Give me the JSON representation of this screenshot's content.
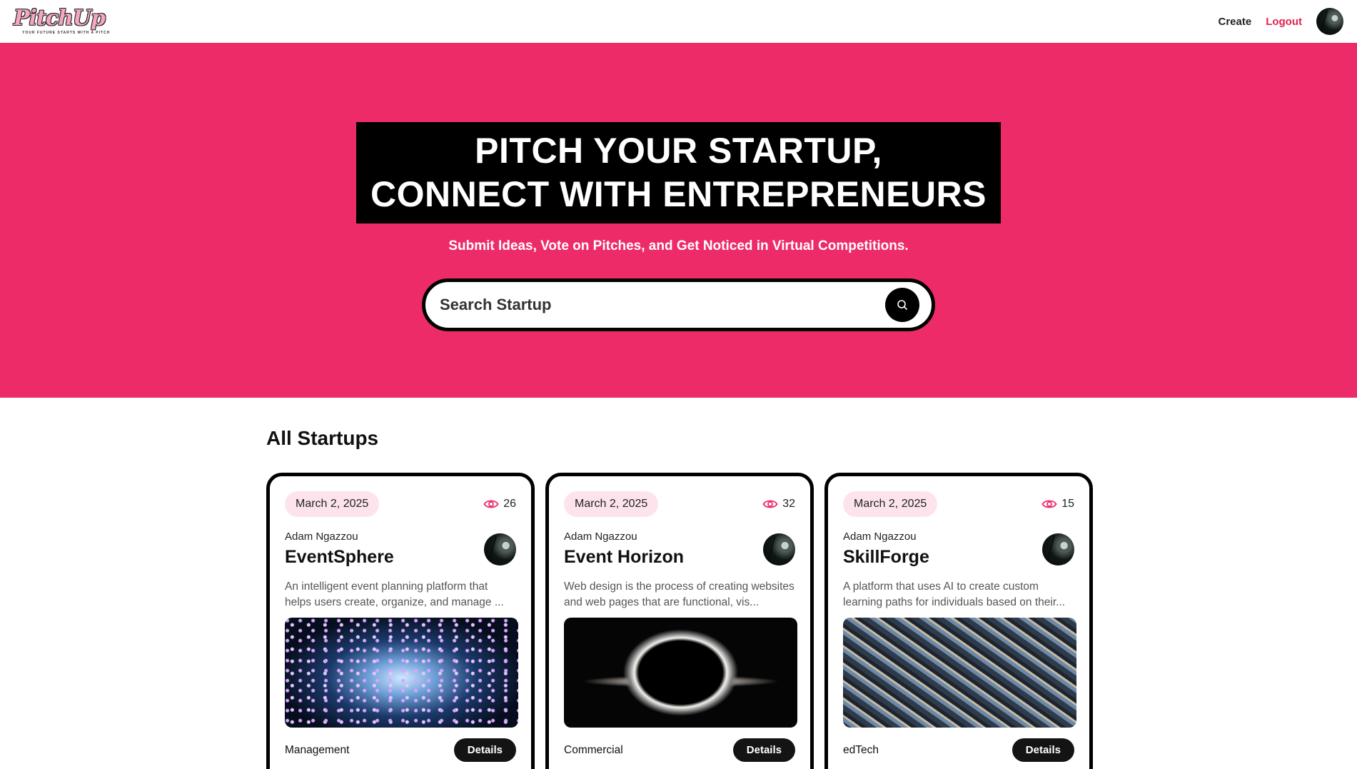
{
  "nav": {
    "logo_text": "PitchUp",
    "logo_tagline": "YOUR FUTURE STARTS WITH A PITCH",
    "create_label": "Create",
    "logout_label": "Logout"
  },
  "hero": {
    "title_line1": "PITCH YOUR STARTUP,",
    "title_line2": "CONNECT WITH ENTREPRENEURS",
    "subtitle": "Submit Ideas, Vote on Pitches, and Get Noticed in Virtual Competitions.",
    "search_placeholder": "Search Startup"
  },
  "section": {
    "title": "All Startups"
  },
  "startups": [
    {
      "date": "March 2, 2025",
      "views": "26",
      "author": "Adam Ngazzou",
      "name": "EventSphere",
      "description": "An intelligent event planning platform that helps users create, organize, and manage ...",
      "category": "Management",
      "details_label": "Details"
    },
    {
      "date": "March 2, 2025",
      "views": "32",
      "author": "Adam Ngazzou",
      "name": "Event Horizon",
      "description": "Web design is the process of creating websites and web pages that are functional, vis...",
      "category": "Commercial",
      "details_label": "Details"
    },
    {
      "date": "March 2, 2025",
      "views": "15",
      "author": "Adam Ngazzou",
      "name": "SkillForge",
      "description": "A platform that uses AI to create custom learning paths for individuals based on their...",
      "category": "edTech",
      "details_label": "Details"
    }
  ],
  "colors": {
    "brand_pink": "#ee2b69",
    "logout_red": "#e3214e",
    "badge_pink": "#fde4ec"
  }
}
